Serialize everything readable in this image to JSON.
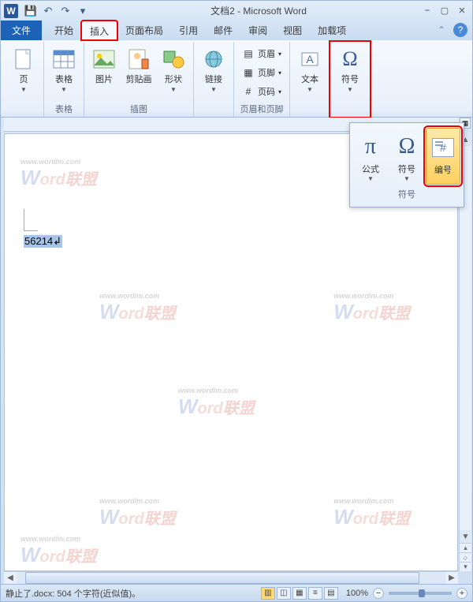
{
  "title": "文档2 - Microsoft Word",
  "qat": {
    "save": "💾",
    "undo": "↶",
    "redo": "↷",
    "more": "▾"
  },
  "win": {
    "min": "⎯",
    "max": "▢",
    "close": "✕"
  },
  "tabs": {
    "file": "文件",
    "items": [
      "开始",
      "插入",
      "页面布局",
      "引用",
      "邮件",
      "审阅",
      "视图",
      "加载项"
    ],
    "active_index": 1
  },
  "ribbon": {
    "groups": {
      "pages": {
        "label": "",
        "page": "页"
      },
      "tables": {
        "label": "表格",
        "table": "表格"
      },
      "illus": {
        "label": "插图",
        "picture": "图片",
        "clipart": "剪贴画",
        "shapes": "形状"
      },
      "links": {
        "label": "",
        "link": "链接"
      },
      "hf": {
        "label": "页眉和页脚",
        "header": "页眉",
        "footer": "页脚",
        "pagenum": "页码"
      },
      "text": {
        "label": "",
        "textbox": "文本"
      },
      "symbols": {
        "label": "",
        "symbol": "符号"
      }
    }
  },
  "dropdown": {
    "equation": "公式",
    "symbol": "符号",
    "number": "编号",
    "group_label": "符号"
  },
  "document": {
    "selected_text": "56214"
  },
  "status": {
    "left": "静止了.docx: 504 个字符(近似值)。",
    "zoom": "100%"
  },
  "watermark": {
    "text": "Word联盟",
    "url": "www.wordlm.com"
  }
}
